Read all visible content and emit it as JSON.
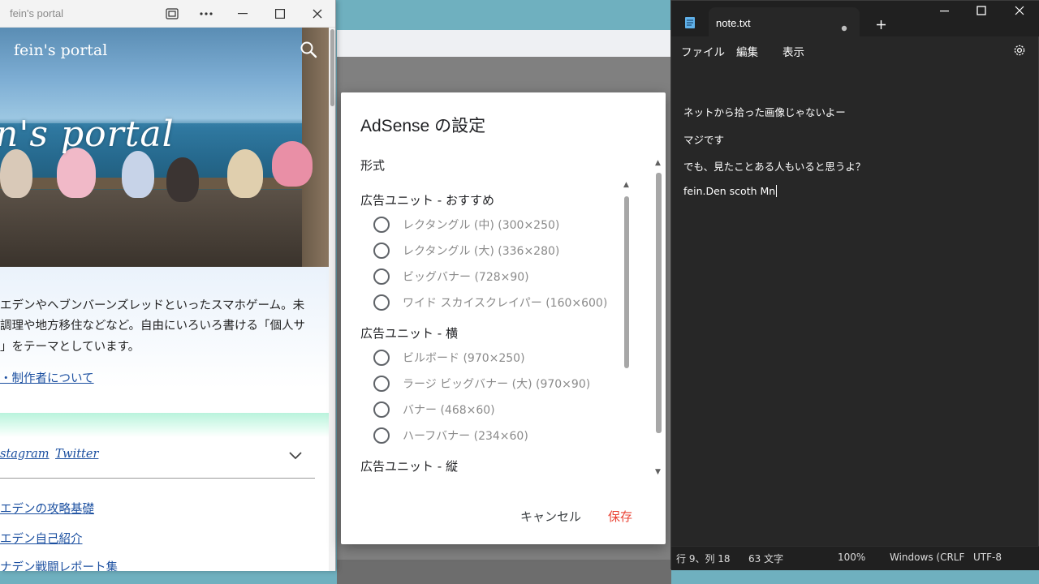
{
  "browser": {
    "window_title": "fein's portal",
    "site_name": "fein's portal",
    "hero_script": "n's portal",
    "description": [
      "エデンやヘブンバーンズレッドといったスマホゲーム。未",
      "調理や地方移住などなど。自由にいろいろ書ける「個人サ",
      "」をテーマとしています。"
    ],
    "about_link": "・制作者について",
    "social": [
      "stagram",
      "Twitter"
    ],
    "menu_links": [
      "エデンの攻略基礎",
      "エデン自己紹介",
      "ナデン戦闘レポート集"
    ]
  },
  "dialog": {
    "title": "AdSense の設定",
    "format_label": "形式",
    "groups": [
      {
        "label": "広告ユニット - おすすめ",
        "options": [
          "レクタングル (中) (300×250)",
          "レクタングル (大) (336×280)",
          "ビッグバナー (728×90)",
          "ワイド スカイスクレイパー (160×600)"
        ]
      },
      {
        "label": "広告ユニット - 横",
        "options": [
          "ビルボード (970×250)",
          "ラージ ビッグバナー (大) (970×90)",
          "バナー (468×60)",
          "ハーフバナー (234×60)"
        ]
      },
      {
        "label": "広告ユニット - 縦",
        "options": []
      }
    ],
    "cancel_label": "キャンセル",
    "save_label": "保存",
    "accent_color": "#ea4335"
  },
  "notepad": {
    "tab_title": "note.txt",
    "menu": [
      "ファイル",
      "編集",
      "表示"
    ],
    "lines": [
      "ネットから拾った画像じゃないよー",
      "マジです",
      "でも、見たことある人もいると思うよ？",
      "fein.Den scoth Mn"
    ],
    "status": {
      "position": "行 9、列 18",
      "chars": "63 文字",
      "zoom": "100%",
      "line_ending": "Windows (CRLF",
      "encoding": "UTF-8"
    }
  }
}
